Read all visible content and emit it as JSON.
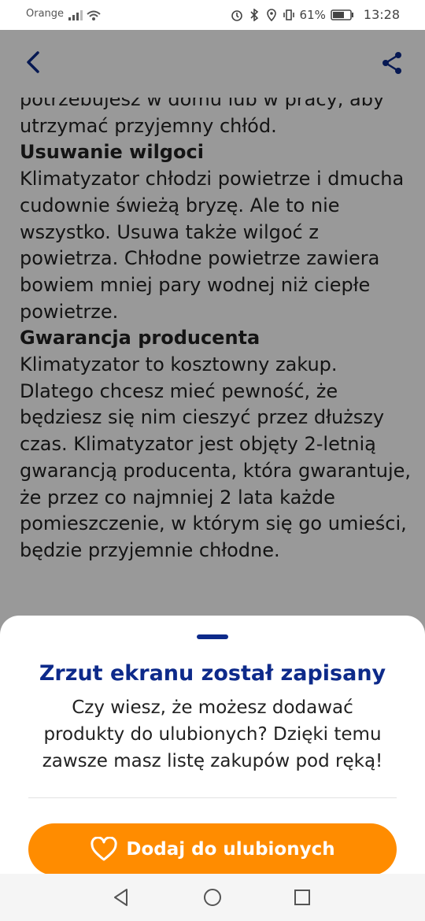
{
  "status": {
    "carrier": "Orange",
    "battery": "61%",
    "time": "13:28"
  },
  "article": {
    "partial_line": "potrzebujesz w domu lub w pracy, aby",
    "lines": [
      {
        "type": "p",
        "text": "utrzymać przyjemny chłód."
      },
      {
        "type": "h",
        "text": "Usuwanie wilgoci"
      },
      {
        "type": "p",
        "text": "Klimatyzator chłodzi powietrze i dmucha cudownie świeżą bryzę. Ale to nie wszystko. Usuwa także wilgoć z powietrza. Chłodne powietrze zawiera bowiem mniej pary wodnej niż ciepłe powietrze."
      },
      {
        "type": "h",
        "text": "Gwarancja producenta"
      },
      {
        "type": "p",
        "text": "Klimatyzator to kosztowny zakup. Dlatego chcesz mieć pewność, że będziesz się nim cieszyć przez dłuższy czas. Klimatyzator jest objęty 2-letnią gwarancją producenta, która gwarantuje, że przez co najmniej 2 lata każde pomieszczenie, w którym się go umieści, będzie przyjemnie chłodne."
      }
    ]
  },
  "sheet": {
    "title": "Zrzut ekranu został zapisany",
    "text": "Czy wiesz, że możesz dodawać produkty do ulubionych? Dzięki temu zawsze masz listę zakupów pod ręką!",
    "cta_label": "Dodaj do ulubionych"
  },
  "colors": {
    "brand_blue": "#0d2a8a",
    "cta_orange": "#ff8c00"
  }
}
